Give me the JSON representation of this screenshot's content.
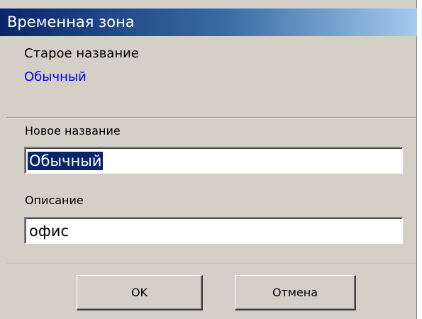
{
  "window": {
    "title": "Временная зона"
  },
  "old_name": {
    "label": "Старое название",
    "value": "Обычный"
  },
  "new_name": {
    "label": "Новое название",
    "value": "Обычный"
  },
  "description": {
    "label": "Описание",
    "value": "офис"
  },
  "buttons": {
    "ok_label": "OK",
    "cancel_label": "Отмена"
  },
  "colors": {
    "dialog_background": "#d4d0c8",
    "titlebar_start": "#0a246a",
    "titlebar_end": "#a6caf0",
    "old_value_text": "#0000ff",
    "selection_background": "#0a246a"
  }
}
